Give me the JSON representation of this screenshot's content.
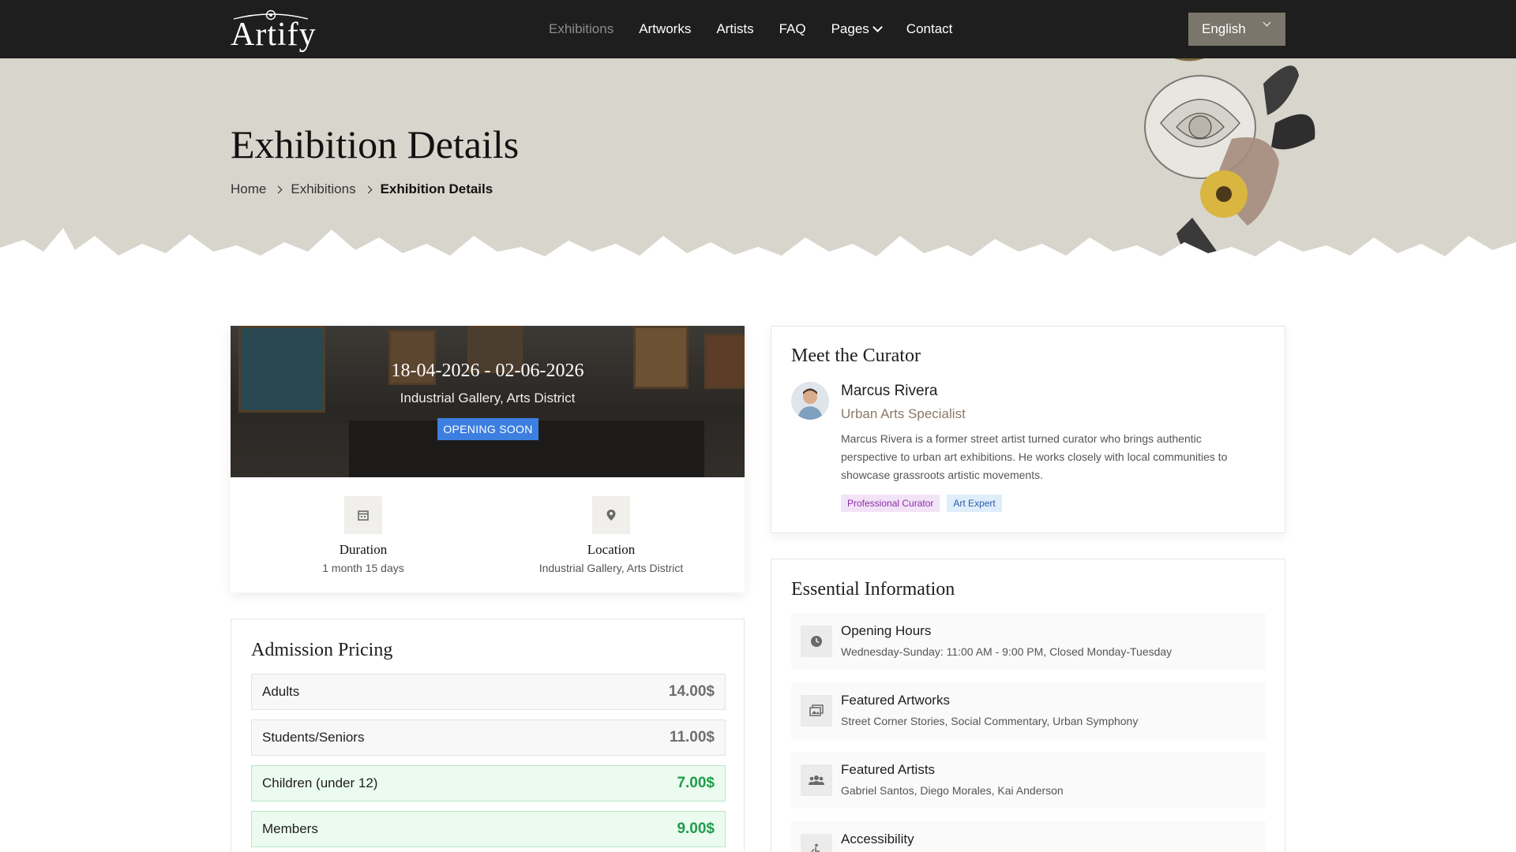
{
  "nav": {
    "logo_text": "Artify",
    "items": [
      {
        "label": "Exhibitions",
        "active": true
      },
      {
        "label": "Artworks",
        "active": false
      },
      {
        "label": "Artists",
        "active": false
      },
      {
        "label": "FAQ",
        "active": false
      },
      {
        "label": "Pages",
        "active": false,
        "dropdown": true
      },
      {
        "label": "Contact",
        "active": false
      }
    ],
    "language": "English"
  },
  "hero": {
    "title": "Exhibition Details",
    "breadcrumb": [
      "Home",
      "Exhibitions",
      "Exhibition Details"
    ]
  },
  "exhibition": {
    "dates": "18-04-2026 - 02-06-2026",
    "location": "Industrial Gallery, Arts District",
    "status": "OPENING SOON",
    "duration_label": "Duration",
    "duration_value": "1 month 15 days",
    "location_label": "Location",
    "location_value": "Industrial Gallery, Arts District",
    "icons": [
      "calendar-icon",
      "map-pin-icon"
    ]
  },
  "pricing": {
    "title": "Admission Pricing",
    "rows": [
      {
        "label": "Adults",
        "value": "14.00$",
        "highlight": false
      },
      {
        "label": "Students/Seniors",
        "value": "11.00$",
        "highlight": false
      },
      {
        "label": "Children (under 12)",
        "value": "7.00$",
        "highlight": true
      },
      {
        "label": "Members",
        "value": "9.00$",
        "highlight": true
      }
    ]
  },
  "curator": {
    "title": "Meet the Curator",
    "name": "Marcus Rivera",
    "role": "Urban Arts Specialist",
    "bio": "Marcus Rivera is a former street artist turned curator who brings authentic perspective to urban art exhibitions. He works closely with local communities to showcase grassroots artistic movements.",
    "tags": [
      "Professional Curator",
      "Art Expert"
    ]
  },
  "info": {
    "title": "Essential Information",
    "items": [
      {
        "title": "Opening Hours",
        "value": "Wednesday-Sunday: 11:00 AM - 9:00 PM, Closed Monday-Tuesday",
        "icon": "clock-icon"
      },
      {
        "title": "Featured Artworks",
        "value": "Street Corner Stories, Social Commentary, Urban Symphony",
        "icon": "images-icon"
      },
      {
        "title": "Featured Artists",
        "value": "Gabriel Santos, Diego Morales, Kai Anderson",
        "icon": "users-icon"
      },
      {
        "title": "Accessibility",
        "value": "",
        "icon": "accessibility-icon"
      }
    ]
  },
  "colors": {
    "nav_bg": "#1e1e1e",
    "hero_bg": "#d8d5cc",
    "badge_blue": "#3d7fe0",
    "price_green": "#1e9e4a",
    "language_bg": "#7b766c"
  }
}
